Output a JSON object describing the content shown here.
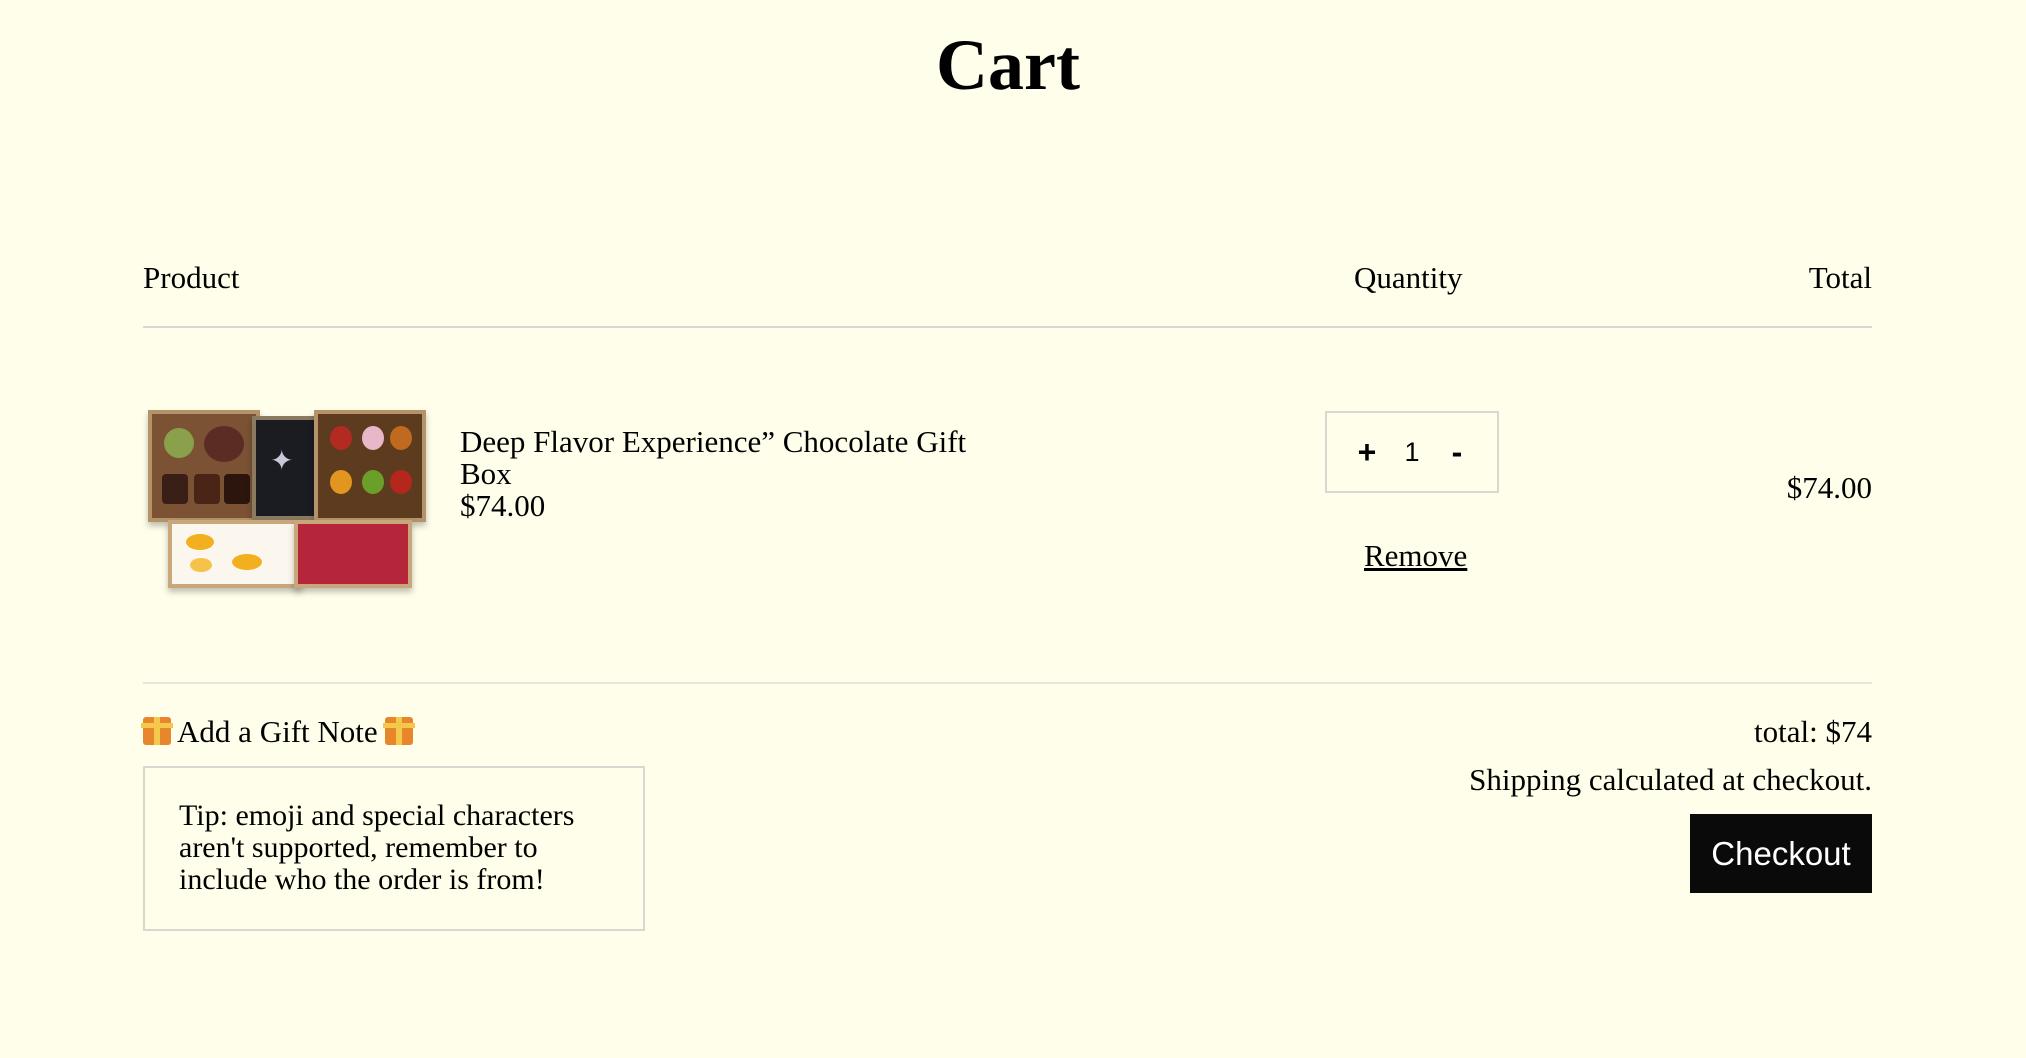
{
  "page": {
    "title": "Cart"
  },
  "table": {
    "headers": {
      "product": "Product",
      "quantity": "Quantity",
      "total": "Total"
    }
  },
  "items": [
    {
      "name": "Deep Flavor Experience” Chocolate Gift Box",
      "price": "$74.00",
      "quantity": "1",
      "increment_label": "+",
      "decrement_label": "-",
      "remove_label": "Remove",
      "line_total": "$74.00",
      "image_icon": "chocolate-gift-box-image"
    }
  ],
  "gift_note": {
    "label": "Add a Gift Note",
    "icon": "gift-icon",
    "placeholder": "Tip: emoji and special characters aren't supported, remember to include who the order is from!",
    "value": ""
  },
  "summary": {
    "total": "total: $74",
    "shipping_note": "Shipping calculated at checkout.",
    "checkout_label": "Checkout"
  },
  "colors": {
    "background": "#fffeea",
    "text": "#000000",
    "button_bg": "#0a0a0a",
    "button_text": "#ffffff",
    "border": "#d8d8d0"
  }
}
